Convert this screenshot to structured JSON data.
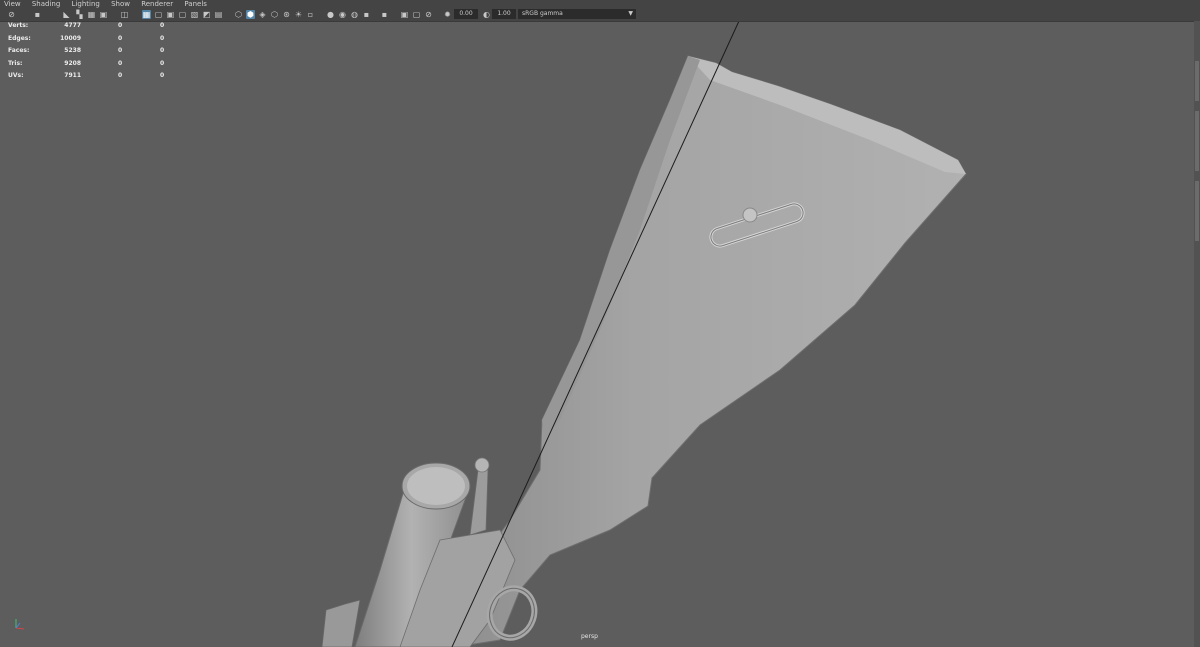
{
  "menu": [
    "View",
    "Shading",
    "Lighting",
    "Show",
    "Renderer",
    "Panels"
  ],
  "toolbar": {
    "exposure_value": "0.00",
    "gamma_value": "1.00",
    "color_space": "sRGB gamma",
    "icons": [
      "select-camera-icon",
      "camera-attributes-icon",
      "bookmark-icon",
      "image-plane-icon",
      "grid-icon",
      "film-gate-icon",
      "resolution-gate-icon",
      "gate-mask-icon",
      "field-chart-icon",
      "safe-action-icon",
      "safe-title-icon",
      "wireframe-icon",
      "smooth-shade-icon",
      "default-material-icon",
      "textured-icon",
      "use-lights-icon",
      "shadows-icon",
      "ambient-occlusion-icon",
      "motion-blur-icon",
      "anti-aliasing-icon",
      "depth-of-field-icon",
      "isolate-select-icon",
      "xray-icon",
      "xray-joints-icon",
      "backface-culling-icon",
      "exposure-icon",
      "gamma-icon",
      "color-management-icon"
    ]
  },
  "hud": {
    "rows": [
      {
        "label": "Verts:",
        "v1": "4777",
        "v2": "0",
        "v3": "0"
      },
      {
        "label": "Edges:",
        "v1": "10009",
        "v2": "0",
        "v3": "0"
      },
      {
        "label": "Faces:",
        "v1": "5238",
        "v2": "0",
        "v3": "0"
      },
      {
        "label": "Tris:",
        "v1": "9208",
        "v2": "0",
        "v3": "0"
      },
      {
        "label": "UVs:",
        "v1": "7911",
        "v2": "0",
        "v3": "0"
      }
    ]
  },
  "viewport": {
    "camera": "persp",
    "background": "#5d5d5d",
    "model_color": "#a9a9a9"
  }
}
